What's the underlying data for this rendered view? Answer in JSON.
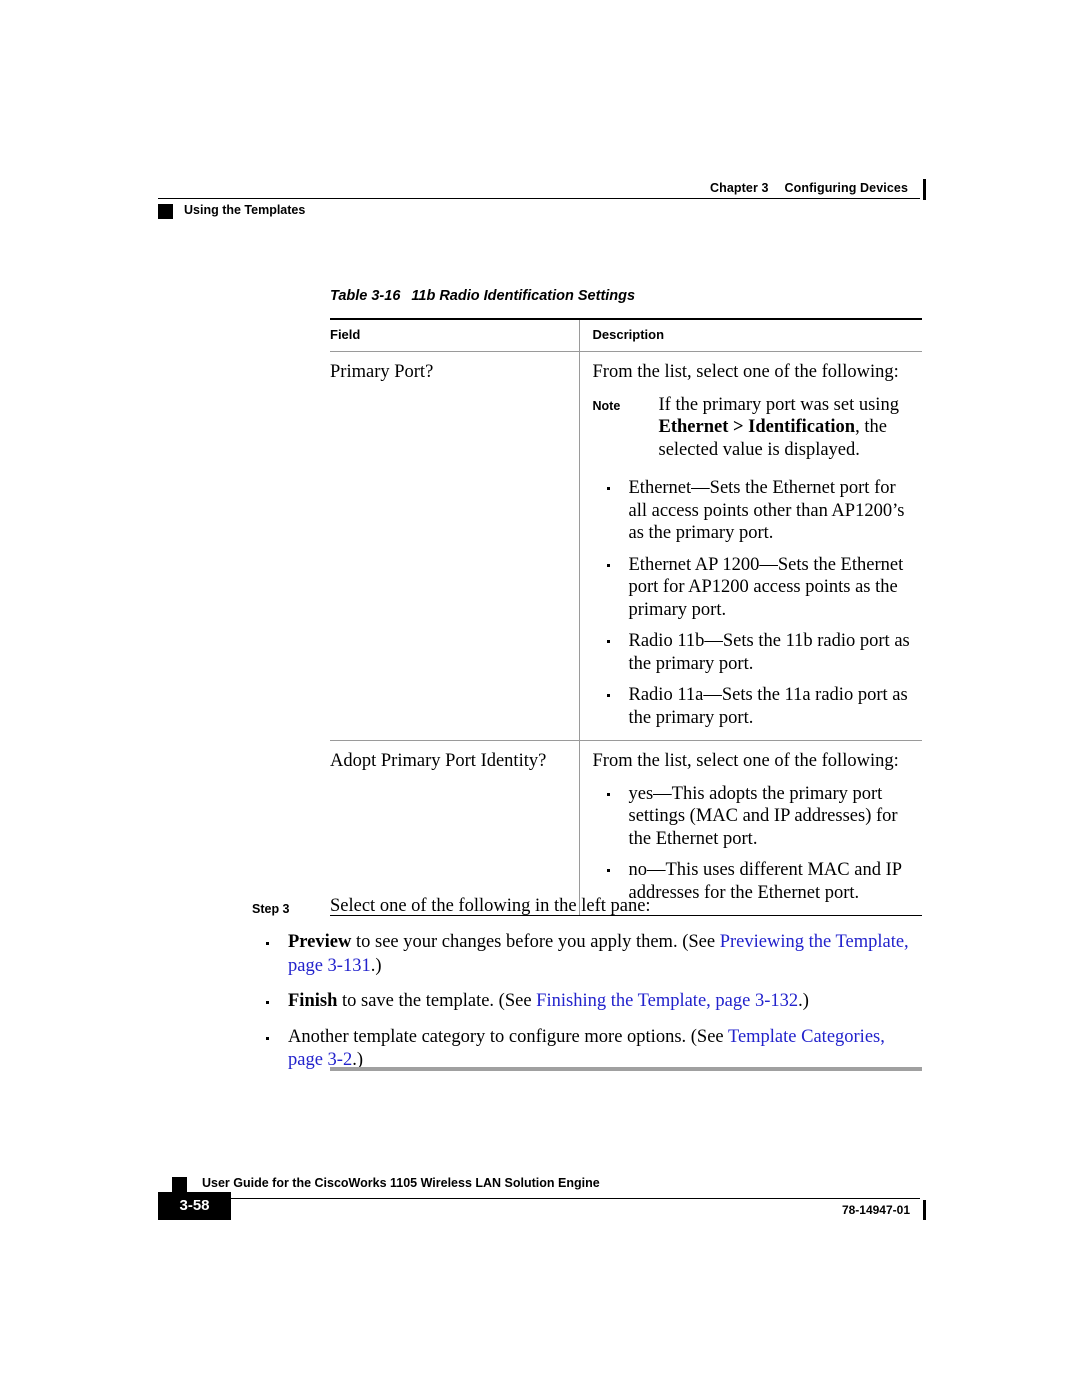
{
  "header": {
    "chapter": "Chapter 3",
    "chapter_title": "Configuring Devices",
    "section": "Using the Templates"
  },
  "table": {
    "caption_label": "Table 3-16",
    "caption_title": "11b Radio Identification Settings",
    "columns": [
      "Field",
      "Description"
    ],
    "rows": [
      {
        "field": "Primary Port?",
        "lead": "From the list, select one of the following:",
        "note": {
          "label": "Note",
          "text_before": "If the primary port was set using ",
          "bold": "Ethernet > Identification",
          "text_after": ", the selected value is displayed."
        },
        "bullets": [
          "Ethernet—Sets the Ethernet port for all access points other than AP1200’s as the primary port.",
          "Ethernet AP 1200—Sets the Ethernet port for AP1200 access points as the primary port.",
          "Radio 11b—Sets the 11b radio port as the primary port.",
          "Radio 11a—Sets the 11a radio port as the primary port."
        ]
      },
      {
        "field": "Adopt Primary Port Identity?",
        "lead": "From the list, select one of the following:",
        "bullets": [
          "yes—This adopts the primary port settings (MAC and IP addresses) for the Ethernet port.",
          "no—This uses different MAC and IP addresses for the Ethernet port."
        ]
      }
    ]
  },
  "step": {
    "label": "Step 3",
    "text": "Select one of the following in the left pane:",
    "bullets": [
      {
        "bold": "Preview",
        "text_before": " to see your changes before you apply them. (See ",
        "link": "Previewing the Template, page 3-131",
        "text_after": ".)"
      },
      {
        "bold": "Finish",
        "text_before": " to save the template. (See ",
        "link": "Finishing the Template, page 3-132",
        "text_after": ".)"
      },
      {
        "bold": "",
        "text_before": "Another template category to configure more options. (See ",
        "link": "Template Categories, page 3-2",
        "text_after": ".)"
      }
    ]
  },
  "footer": {
    "page_number": "3-58",
    "doc_title": "User Guide for the CiscoWorks 1105 Wireless LAN Solution Engine",
    "doc_number": "78-14947-01"
  },
  "colors": {
    "link": "#2222cc",
    "rule_gray": "#9a9a9a",
    "rule_black": "#000000"
  }
}
